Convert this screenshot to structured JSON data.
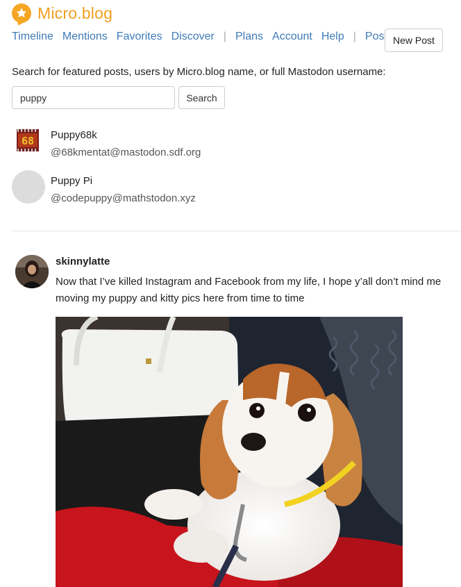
{
  "app": {
    "name": "Micro.blog"
  },
  "nav": {
    "items": [
      "Timeline",
      "Mentions",
      "Favorites",
      "Discover"
    ],
    "items2": [
      "Plans",
      "Account",
      "Help"
    ],
    "items3": [
      "Posts"
    ],
    "new_post": "New Post"
  },
  "search": {
    "prompt": "Search for featured posts, users by Micro.blog name, or full Mastodon username:",
    "value": "puppy",
    "button": "Search"
  },
  "results": [
    {
      "name": "Puppy68k",
      "handle": "@68kmentat@mastodon.sdf.org",
      "avatar_text": "68"
    },
    {
      "name": "Puppy Pi",
      "handle": "@codepuppy@mathstodon.xyz"
    }
  ],
  "post": {
    "username": "skinnylatte",
    "text": "Now that I’ve killed Instagram and Facebook from my life, I hope y’all don’t mind me moving my puppy and kitty pics here from time to time"
  },
  "colors": {
    "brand": "#f0a020",
    "link": "#3f7bb8"
  }
}
